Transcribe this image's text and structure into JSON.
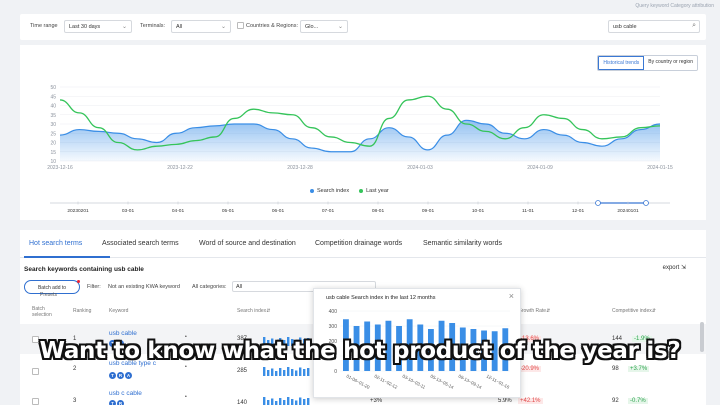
{
  "top_link": "Query keyword Category attribution",
  "filters": {
    "time_range_label": "Time range",
    "time_range_value": "Last 30 days",
    "terminals_label": "Terminals:",
    "terminals_value": "All",
    "countries_label": "Countries & Regions:",
    "countries_value": "Glo...",
    "search_value": "usb cable"
  },
  "chart_toggle": {
    "historical": "Historical trends",
    "by_country": "By country or region"
  },
  "chart_data": {
    "type": "area",
    "yticks": [
      50,
      45,
      40,
      35,
      30,
      25,
      20,
      15,
      10
    ],
    "ylim": [
      10,
      50
    ],
    "xticks": [
      "2023-12-16",
      "2023-12-22",
      "2023-12-28",
      "2024-01-03",
      "2024-01-09",
      "2024-01-15"
    ],
    "series": [
      {
        "name": "Search index",
        "color": "#3a8ee6",
        "values": [
          24,
          27,
          26,
          25,
          22,
          20,
          25,
          28,
          29,
          30,
          30,
          27,
          22,
          17,
          15,
          15,
          22,
          28,
          23,
          16,
          24,
          32,
          30,
          25,
          22,
          27,
          24,
          20,
          18,
          22,
          27,
          30
        ]
      },
      {
        "name": "Last year",
        "color": "#35c45a",
        "values": [
          43,
          36,
          28,
          20,
          16,
          18,
          19,
          21,
          23,
          33,
          38,
          36,
          35,
          28,
          23,
          20,
          18,
          33,
          43,
          45,
          38,
          30,
          26,
          22,
          28,
          35,
          33,
          27,
          22,
          23,
          28,
          29
        ]
      }
    ],
    "timeline_ticks": [
      "20230201",
      "03-01",
      "04-01",
      "05-01",
      "06-01",
      "07-01",
      "08-01",
      "09-01",
      "10-01",
      "11-01",
      "12-01",
      "20240101"
    ]
  },
  "tabs": [
    "Hot search terms",
    "Associated search terms",
    "Word of source and destination",
    "Competition drainage words",
    "Semantic similarity words"
  ],
  "section_title": "Search keywords containing usb cable",
  "export_label": "export",
  "batch_button": "Batch add to",
  "batch_sub": "Presets",
  "filter_label": "Filter:",
  "filter_value": "Not an existing KWA keyword",
  "categories_label": "All categories:",
  "categories_value": "All",
  "table": {
    "headers": [
      "Batch selection",
      "Ranking",
      "Keyword",
      "Search index",
      "Growth Rate",
      "Competitive index"
    ],
    "rows": [
      {
        "rank": "1",
        "keyword": "usb cable",
        "search": "387",
        "growth_rate": "-13.6%",
        "competitive": "144",
        "comp_change": "-1.9%",
        "badges": [
          "T",
          "R"
        ]
      },
      {
        "rank": "2",
        "keyword": "usb cable type c",
        "search": "285",
        "growth_rate": "-20.9%",
        "competitive": "98",
        "comp_change": "+3.7%",
        "badges": [
          "T",
          "R",
          "A"
        ]
      },
      {
        "rank": "3",
        "keyword": "usb c cable",
        "search": "140",
        "growth_pct": "+3%",
        "extra": "5.9%",
        "growth_rate": "+42.1%",
        "competitive": "92",
        "comp_change": "-0.7%",
        "badges": [
          "T",
          "R"
        ]
      }
    ]
  },
  "popup": {
    "title": "usb cable Search index in the last 12 months",
    "chart_data": {
      "type": "bar",
      "ylim": [
        0,
        400
      ],
      "yticks": [
        400,
        300,
        200,
        100,
        0
      ],
      "values": [
        345,
        300,
        330,
        310,
        335,
        300,
        345,
        310,
        280,
        335,
        320,
        290,
        280,
        270,
        265,
        285
      ],
      "xlabels": [
        "01-06~01-20",
        "02-11~02-12",
        "03-10~03-11",
        "05-13~05-14",
        "09-13~09-14",
        "12-11~01-16"
      ]
    }
  },
  "caption": "Want to know what the hot product of the year is?"
}
